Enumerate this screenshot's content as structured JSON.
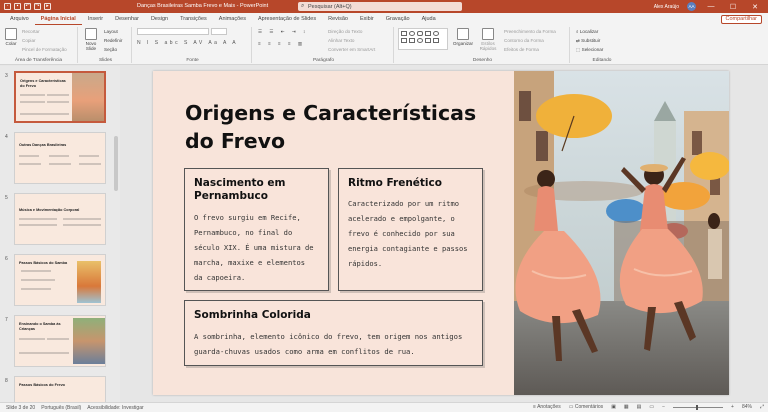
{
  "titlebar": {
    "doc_title": "Danças Brasileiras Samba Frevo e Mais  -  PowerPoint",
    "search_placeholder": "Pesquisar (Alt+Q)",
    "user_name": "Alex Araújo",
    "user_initials": "AA",
    "minimize": "—",
    "maximize": "☐",
    "close": "✕"
  },
  "ribbon_tabs": [
    "Arquivo",
    "Página Inicial",
    "Inserir",
    "Desenhar",
    "Design",
    "Transições",
    "Animações",
    "Apresentação de Slides",
    "Revisão",
    "Exibir",
    "Gravação",
    "Ajuda"
  ],
  "share_label": "Compartilhar",
  "ribbon": {
    "clipboard": {
      "paste": "Colar",
      "cut": "Recortar",
      "copy": "Copiar",
      "format_painter": "Pincel de Formatação",
      "label": "Área de Transferência"
    },
    "slides": {
      "new_slide": "Novo Slide",
      "layout": "Layout",
      "reset": "Redefinir",
      "section": "Seção",
      "label": "Slides"
    },
    "font": {
      "label": "Fonte",
      "format_row": "N I S abc S AV Aa A A"
    },
    "paragraph": {
      "text_direction": "Direção do Texto",
      "align_text": "Alinhar Texto",
      "smartart": "Converter em SmartArt",
      "label": "Parágrafo"
    },
    "drawing": {
      "arrange": "Organizar",
      "quick_styles": "Estilos Rápidos",
      "shape_fill": "Preenchimento da Forma",
      "shape_outline": "Contorno da Forma",
      "shape_effects": "Efeitos de Forma",
      "label": "Desenho"
    },
    "editing": {
      "find": "Localizar",
      "replace": "Substituir",
      "select": "Selecionar",
      "label": "Editando"
    }
  },
  "thumbnails": [
    {
      "num": "3",
      "title": "Origens e Características do Frevo",
      "selected": true
    },
    {
      "num": "4",
      "title": "Outras Danças Brasileiras",
      "selected": false
    },
    {
      "num": "5",
      "title": "Música e Movimentação Corporal",
      "selected": false
    },
    {
      "num": "6",
      "title": "Passos Básicos do Samba",
      "selected": false
    },
    {
      "num": "7",
      "title": "Ensinando o Samba às Crianças",
      "selected": false
    },
    {
      "num": "8",
      "title": "Passos Básicos do Frevo",
      "selected": false
    }
  ],
  "slide": {
    "title": "Origens e Características do Frevo",
    "cards": [
      {
        "heading": "Nascimento em Pernambuco",
        "lines": [
          "O frevo surgiu em Recife,",
          "Pernambuco, no final do",
          "século XIX. É uma mistura de",
          "marcha, maxixe e elementos",
          "da capoeira."
        ]
      },
      {
        "heading": "Ritmo Frenético",
        "lines": [
          "Caracterizado por um ritmo",
          "acelerado e empolgante, o",
          "frevo é conhecido por sua",
          "energia contagiante e passos",
          "rápidos."
        ]
      },
      {
        "heading": "Sombrinha Colorida",
        "lines": [
          "A sombrinha, elemento icônico do frevo, tem origem nos antigos",
          "guarda-chuvas usados como arma em conflitos de rua."
        ]
      }
    ]
  },
  "statusbar": {
    "slide_info": "Slide 3 de 20",
    "language": "Português (Brasil)",
    "accessibility": "Acessibilidade: Investigar",
    "notes": "Anotações",
    "comments": "Comentários",
    "zoom": "84%"
  }
}
